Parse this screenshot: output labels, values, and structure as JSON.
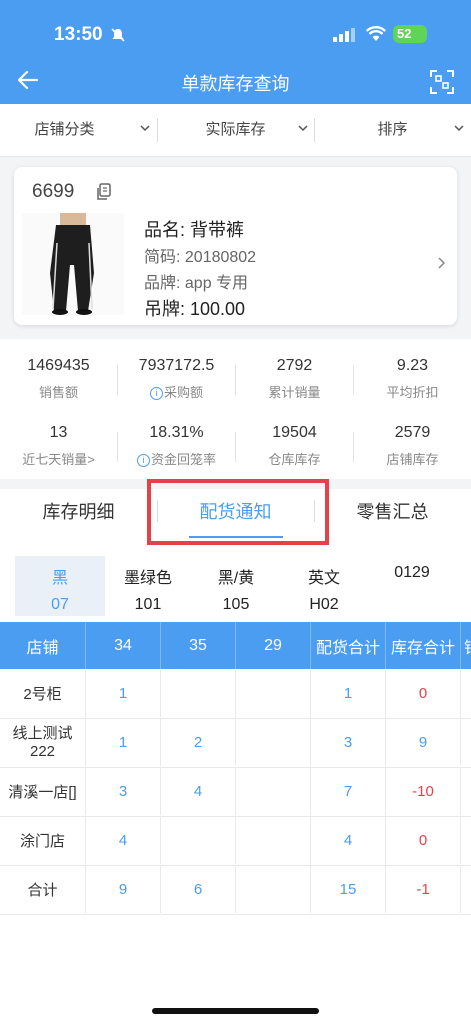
{
  "status": {
    "time": "13:50",
    "battery": "52"
  },
  "nav": {
    "title": "单款库存查询"
  },
  "filters": [
    {
      "label": "店铺分类"
    },
    {
      "label": "实际库存"
    },
    {
      "label": "排序"
    }
  ],
  "product": {
    "code": "6699",
    "name": "品名: 背带裤",
    "short_code": "简码: 20180802",
    "brand": "品牌: app 专用",
    "tag_price": "吊牌: 100.00"
  },
  "stats": [
    {
      "value": "1469435",
      "label": "销售额"
    },
    {
      "value": "7937172.5",
      "label": "采购额"
    },
    {
      "value": "2792",
      "label": "累计销量"
    },
    {
      "value": "9.23",
      "label": "平均折扣"
    },
    {
      "value": "13",
      "label": "近七天销量>"
    },
    {
      "value": "18.31%",
      "label": "资金回笼率"
    },
    {
      "value": "19504",
      "label": "仓库库存"
    },
    {
      "value": "2579",
      "label": "店铺库存"
    }
  ],
  "tabs": [
    {
      "label": "库存明细"
    },
    {
      "label": "配货通知"
    },
    {
      "label": "零售汇总"
    }
  ],
  "colors": [
    {
      "name": "黑",
      "code": "07"
    },
    {
      "name": "墨绿色",
      "code": "101"
    },
    {
      "name": "黑/黄",
      "code": "105"
    },
    {
      "name": "英文",
      "code": "H02"
    },
    {
      "name": "",
      "code": "0129"
    }
  ],
  "table": {
    "headers": [
      "店铺",
      "34",
      "35",
      "29",
      "配货合计",
      "库存合计",
      "销"
    ],
    "rows": [
      {
        "store": "2号柜",
        "s34": "1",
        "s35": "",
        "s29": "",
        "alloc": "1",
        "stock": "0"
      },
      {
        "store": "线上测试222",
        "s34": "1",
        "s35": "2",
        "s29": "",
        "alloc": "3",
        "stock": "9"
      },
      {
        "store": "清溪一店[]",
        "s34": "3",
        "s35": "4",
        "s29": "",
        "alloc": "7",
        "stock": "-10"
      },
      {
        "store": "涂门店",
        "s34": "4",
        "s35": "",
        "s29": "",
        "alloc": "4",
        "stock": "0"
      },
      {
        "store": "合计",
        "s34": "9",
        "s35": "6",
        "s29": "",
        "alloc": "15",
        "stock": "-1"
      }
    ]
  }
}
